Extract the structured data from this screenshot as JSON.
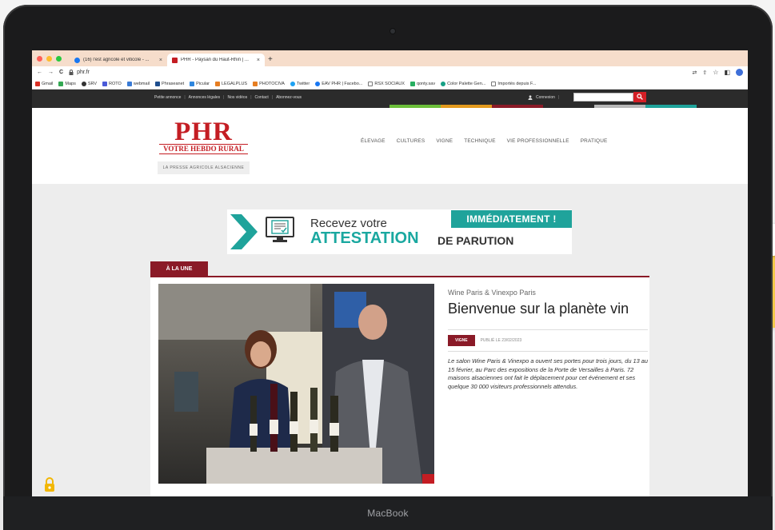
{
  "device": {
    "brand_label": "MacBook"
  },
  "browser": {
    "tabs": [
      {
        "title": "(16) l'est agricole et viticole - ...",
        "close": "×",
        "active": false
      },
      {
        "title": "PHR - Paysan du Haut-Rhin | ...",
        "close": "×",
        "active": true
      }
    ],
    "new_tab": "+",
    "nav": {
      "back": "←",
      "forward": "→",
      "reload": "C"
    },
    "url": "phr.fr",
    "bookmarks": [
      {
        "label": "Gmail",
        "color": "#d93025"
      },
      {
        "label": "Maps",
        "color": "#34a853"
      },
      {
        "label": "SRV",
        "color": "#333333"
      },
      {
        "label": "ROTO",
        "color": "#4a5ad8"
      },
      {
        "label": "webmail",
        "color": "#3a7bd5"
      },
      {
        "label": "Phraseanet",
        "color": "#1f4f8f"
      },
      {
        "label": "Picular",
        "color": "#2e86de"
      },
      {
        "label": "LEGALPLUS",
        "color": "#e67e22"
      },
      {
        "label": "PHOTOCIVA",
        "color": "#e67e22"
      },
      {
        "label": "Twitter",
        "color": "#1da1f2"
      },
      {
        "label": "EAV PHR | Facebo...",
        "color": "#1877f2"
      },
      {
        "label": "RSX SOCIAUX",
        "color": "#888888"
      },
      {
        "label": "qonty.sav",
        "color": "#27ae60"
      },
      {
        "label": "Color Palette Gen...",
        "color": "#16a085"
      },
      {
        "label": "Importés depuis F...",
        "color": "#888888"
      }
    ]
  },
  "site": {
    "top_links": [
      "Petite annonce",
      "Annonces légales",
      "Nos vidéos",
      "Contact",
      "Abonnez-vous"
    ],
    "login_label": "Connexion",
    "search_placeholder": "",
    "color_strip": [
      "#2b2b2b",
      "#2b2b2b",
      "#2b2b2b",
      "#2b2b2b",
      "#2b2b2b",
      "#2b2b2b",
      "#2b2b2b",
      "#6cbf3a",
      "#e39a1d",
      "#8a1a27",
      "#2b2b2b",
      "#b7b7b7",
      "#1fa39b",
      "#2b2b2b"
    ],
    "logo": {
      "name": "PHR",
      "subtitle": "VOTRE HEBDO RURAL",
      "tagline": "LA PRESSE AGRICOLE ALSACIENNE"
    },
    "main_nav": [
      "ÉLEVAGE",
      "CULTURES",
      "VIGNE",
      "TECHNIQUE",
      "VIE PROFESSIONNELLE",
      "PRATIQUE"
    ],
    "banner": {
      "line1": "Recevez votre",
      "line2": "ATTESTATION",
      "line3": "DE PARUTION",
      "badge": "IMMÉDIATEMENT !"
    },
    "section_tag": "À LA UNE",
    "article": {
      "kicker": "Wine Paris & Vinexpo Paris",
      "title": "Bienvenue sur la planète vin",
      "rubric": "VIGNE",
      "date": "PUBLIÉ LE 23/02/2023",
      "excerpt": "Le salon Wine Paris & Vinexpo a ouvert ses portes pour trois jours, du 13 au 15 février, au Parc des expositions de la Porte de Versailles à Paris. 72 maisons alsaciennes ont fait le déplacement pour cet événement et ses quelque 30 000 visiteurs professionnels attendus."
    },
    "colors": {
      "brand_red": "#c41d23",
      "rubric_wine": "#8a1a27",
      "teal": "#1fa39b"
    }
  }
}
